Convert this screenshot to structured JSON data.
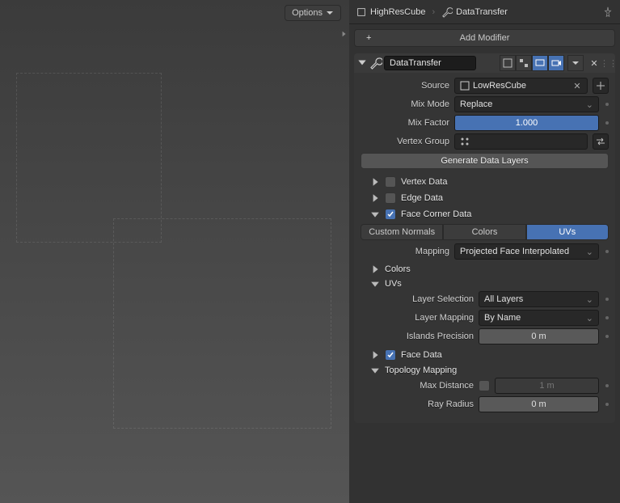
{
  "viewport": {
    "options_label": "Options"
  },
  "breadcrumb": {
    "object": "HighResCube",
    "modifier": "DataTransfer"
  },
  "add_modifier_label": "Add Modifier",
  "modifier": {
    "name": "DataTransfer",
    "source": {
      "label": "Source",
      "value": "LowResCube"
    },
    "mix_mode": {
      "label": "Mix Mode",
      "value": "Replace"
    },
    "mix_factor": {
      "label": "Mix Factor",
      "value": "1.000"
    },
    "vertex_group": {
      "label": "Vertex Group",
      "value": ""
    },
    "generate_layers_label": "Generate Data Layers",
    "sections": {
      "vertex_data": {
        "label": "Vertex Data",
        "checked": false
      },
      "edge_data": {
        "label": "Edge Data",
        "checked": false
      },
      "face_corner_data": {
        "label": "Face Corner Data",
        "checked": true
      },
      "face_data": {
        "label": "Face Data",
        "checked": true
      },
      "topology_mapping": {
        "label": "Topology Mapping"
      },
      "colors_sub": "Colors",
      "uvs_sub": "UVs"
    },
    "face_corner_tabs": {
      "normals": "Custom Normals",
      "colors": "Colors",
      "uvs": "UVs"
    },
    "mapping": {
      "label": "Mapping",
      "value": "Projected Face Interpolated"
    },
    "layer_selection": {
      "label": "Layer Selection",
      "value": "All Layers"
    },
    "layer_mapping": {
      "label": "Layer Mapping",
      "value": "By Name"
    },
    "islands_precision": {
      "label": "Islands Precision",
      "value": "0 m"
    },
    "max_distance": {
      "label": "Max Distance",
      "value": "1 m"
    },
    "ray_radius": {
      "label": "Ray Radius",
      "value": "0 m"
    }
  }
}
